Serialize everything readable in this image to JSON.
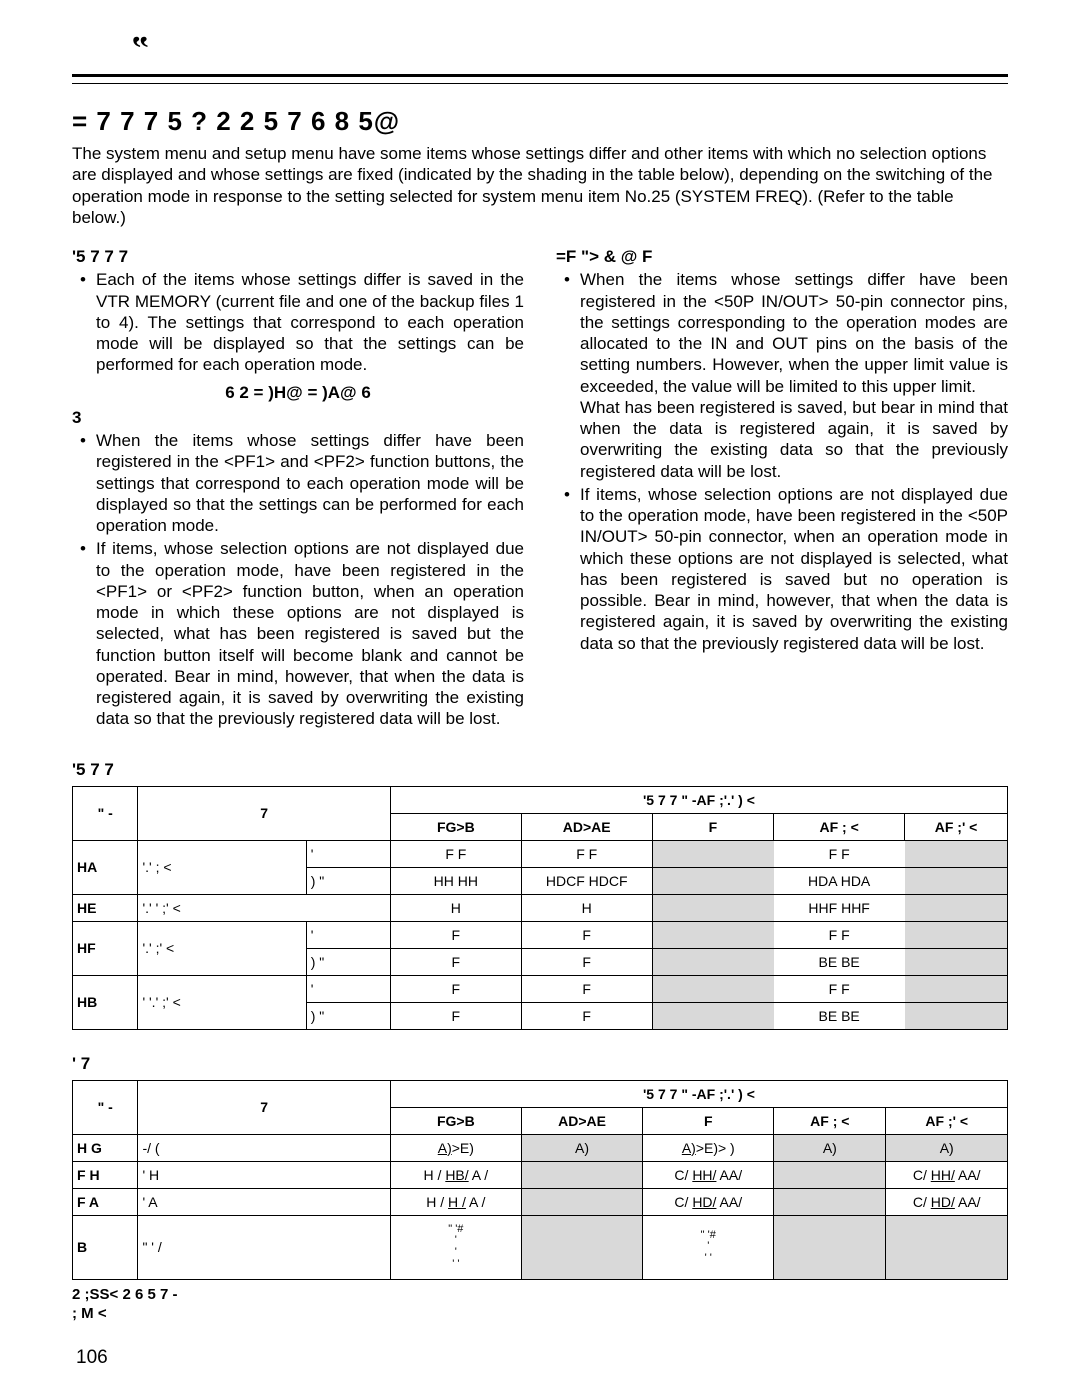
{
  "header_mark": "‟",
  "heading": "=    7   7      7  5    ?   2      2  5   7 6  8    5@",
  "intro": "The system menu and setup menu have some items whose settings differ and other items with which no selection options are displayed and whose settings are fixed (indicated by the shading in the table below), depending on the switching of the operation mode in response to the setting selected for system menu item No.25 (SYSTEM FREQ).  (Refer to the table below.)",
  "left": {
    "h1": "'5   7 7           7",
    "b1": "Each of the items whose settings differ is saved in the VTR MEMORY (current file and one of the backup files 1 to 4).  The settings that correspond to each operation mode will be displayed so that the settings can be performed for each operation mode.",
    "center": "6   2    = )H@        = )A@  6",
    "h2": "3",
    "b2": "When the items whose settings differ have been registered in the <PF1> and <PF2> function buttons, the settings that correspond to each operation mode will be displayed so that the settings can be performed for each operation mode.",
    "b3": "If items, whose selection options are not displayed due to  the operation mode, have been registered in the <PF1> or <PF2> function button, when an operation mode in which these options are not displayed is selected, what has been registered is saved but the function button itself will become blank and cannot be operated.  Bear in mind, however, that when the data is registered again, it is saved by overwriting the existing data so that the previously registered data will be lost."
  },
  "right": {
    "h1": "=F     \"> & @ F",
    "b1": "When the items whose settings differ have been registered in the <50P IN/OUT> 50-pin connector pins, the settings corresponding to the operation modes are allocated to the IN and OUT pins on the basis of the setting numbers.  However, when the upper limit value is exceeded, the value will be limited to this upper limit.",
    "b1b": "What has been registered is saved, but bear in mind that when the data is registered again, it is saved by overwriting the existing data so that the previously registered data will be lost.",
    "b2": "If items, whose selection options are not displayed due to the operation mode, have been registered in the <50P IN/OUT> 50-pin connector, when an operation mode in which these options are not displayed is selected, what has been registered is saved but no operation is possible.  Bear in mind, however, that when the data is registered again, it is saved by overwriting the existing data so that the previously registered data will be lost."
  },
  "t1": {
    "title": "'5    7 7",
    "grouphead": "'5   7 7    \" -AF ;'.'    )  <",
    "cols": {
      "no": "\" -",
      "item": "7",
      "c1": "FG>B",
      "c2": "AD>AE",
      "c3": "F",
      "c4": "AF ; <",
      "c5": "AF ;' <"
    },
    "rows": [
      {
        "no": "HA",
        "item": "'.'   ;  <",
        "sub": "'",
        "c1": "F        F",
        "c2": "F        F",
        "c3s": true,
        "c45": "F        F",
        "c5s": true
      },
      {
        "sub": ") \"",
        "c1": "HH      HH",
        "c2": "HDCF    HDCF",
        "c3s": true,
        "c45": "HDA      HDA",
        "c5s": true
      },
      {
        "no": "HE",
        "item": "'.' '   ;' <",
        "sub": "",
        "span": true,
        "c1": "H",
        "c2": "H",
        "c3s": true,
        "c45": "HHF      HHF",
        "c5s": true
      },
      {
        "no": "HF",
        "item": "'.'   ;' <",
        "sub": "'",
        "c1": "F",
        "c2": "F",
        "c3s": true,
        "c45": "F        F",
        "c5s": true
      },
      {
        "sub": ") \"",
        "c1": "F",
        "c2": "F",
        "c3s": true,
        "c45": "BE       BE",
        "c5s": true
      },
      {
        "no": "HB",
        "item": "'  '.'   ;' <",
        "sub": "'",
        "c1": "F",
        "c2": "F",
        "c3s": true,
        "c45": "F        F",
        "c5s": true
      },
      {
        "sub": ") \"",
        "c1": "F",
        "c2": "F",
        "c3s": true,
        "c45": "BE       BE",
        "c5s": true
      }
    ]
  },
  "t2": {
    "title": "'       7",
    "grouphead": "'5   7 7    \" -AF ;'.'    )  <",
    "cols": {
      "no": "\" -",
      "item": "7",
      "c1": "FG>B",
      "c2": "AD>AE",
      "c3": "F",
      "c4": "AF ; <",
      "c5": "AF ;' <"
    },
    "rows": [
      {
        "no": "H G",
        "item": "-/  (",
        "c1": {
          "u": "A)",
          "rest": ">E)"
        },
        "c2": "A)",
        "c2s": true,
        "c3": {
          "u": "A)",
          "rest": ">E)> )"
        },
        "c4": "A)",
        "c4s": true,
        "c5": "A)",
        "c5s": true
      },
      {
        "no": "F H",
        "item": "' H",
        "c1": "H /   HB/    A /",
        "c1u": 1,
        "c2s": true,
        "c3": "C/   HH/    AA/",
        "c3u": 1,
        "c4s": true,
        "c5": "C/   HH/    AA/",
        "c5u": 1
      },
      {
        "no": "F A",
        "item": "' A",
        "c1": "H /   H /    A /",
        "c1u": 1,
        "c2s": true,
        "c3": "C/   HD/    AA/",
        "c3u": 1,
        "c4s": true,
        "c5": "C/   HD/    AA/",
        "c5u": 1
      },
      {
        "no": "B",
        "item": "\" '  /",
        "stack1": [
          "\"  '#",
          "'",
          "'",
          "' '"
        ],
        "c2s": true,
        "stack3": [
          "\"  '#",
          "'",
          "' '"
        ],
        "c4s": true,
        "c5s": true
      }
    ]
  },
  "footnotes": [
    "2          ;SS<        2 6   5        7  -",
    ";            M     <"
  ],
  "pagenum": "106"
}
